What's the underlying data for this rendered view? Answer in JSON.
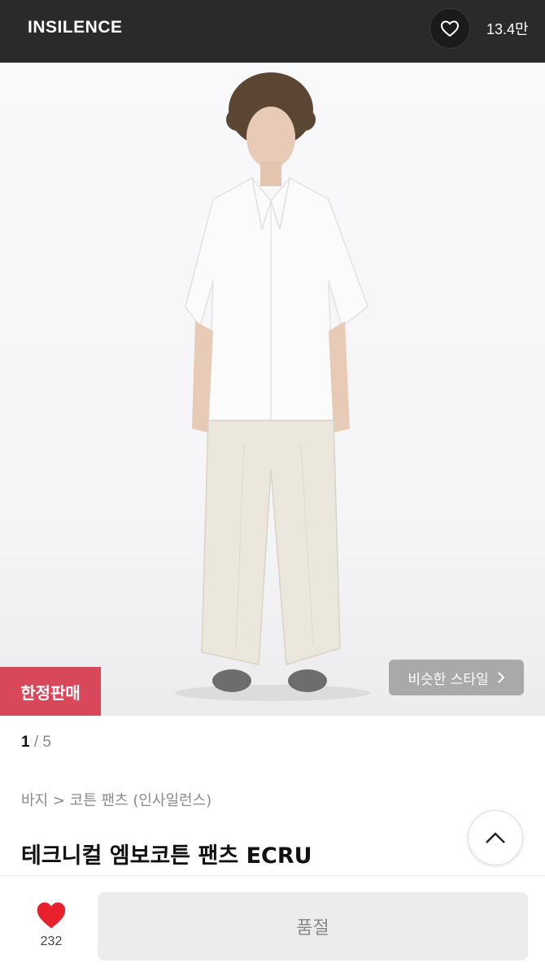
{
  "header": {
    "brand": "INSILENCE",
    "like_count": "13.4만"
  },
  "hero": {
    "badge_limited": "한정판매",
    "similar_style_label": "비슷한 스타일"
  },
  "pager": {
    "current": "1",
    "separator": " / ",
    "total": "5"
  },
  "product": {
    "breadcrumb": "바지 > 코튼 팬츠 (인사일런스)",
    "title": "테크니컬 엠보코튼 팬츠 ECRU"
  },
  "bottom_bar": {
    "heart_count": "232",
    "action_label": "품절"
  },
  "colors": {
    "header_bg": "#2a2a2a",
    "limited_badge": "#d9475a",
    "heart": "#e8202b"
  }
}
